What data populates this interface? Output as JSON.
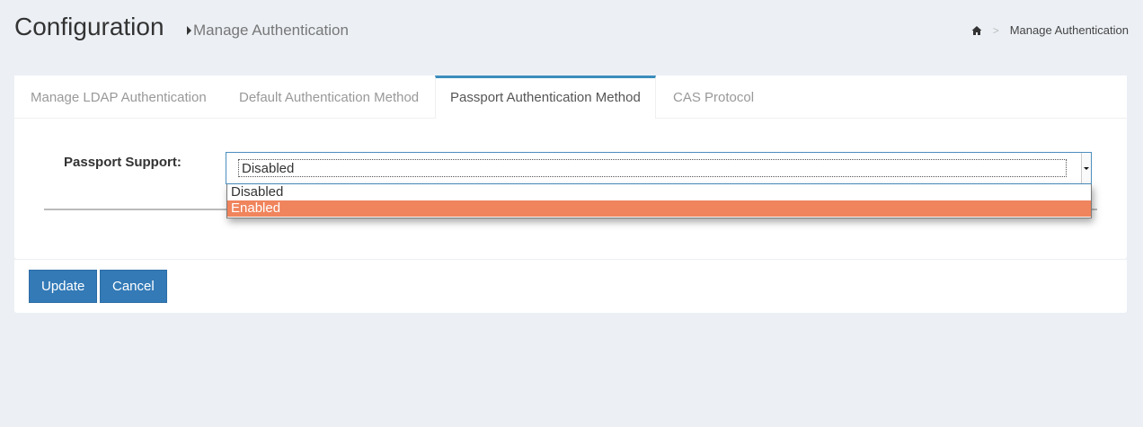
{
  "header": {
    "title": "Configuration",
    "subtitle": "Manage Authentication"
  },
  "breadcrumb": {
    "home_icon": "home-icon",
    "separator": ">",
    "current": "Manage Authentication"
  },
  "tabs": [
    {
      "label": "Manage LDAP Authentication",
      "active": false
    },
    {
      "label": "Default Authentication Method",
      "active": false
    },
    {
      "label": "Passport Authentication Method",
      "active": true
    },
    {
      "label": "CAS Protocol",
      "active": false
    }
  ],
  "form": {
    "passport_label": "Passport Support:",
    "passport_value": "Disabled",
    "options": [
      "Disabled",
      "Enabled"
    ],
    "highlighted_option": "Enabled"
  },
  "buttons": {
    "update": "Update",
    "cancel": "Cancel"
  },
  "colors": {
    "accent": "#3c8dbc",
    "button": "#337ab7",
    "highlight": "#f0845c",
    "background": "#ecf0f5"
  }
}
